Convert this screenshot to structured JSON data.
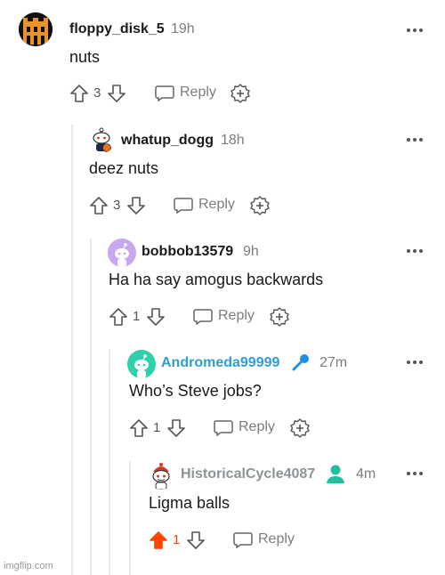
{
  "comments": [
    {
      "username": "floppy_disk_5",
      "time": "19h",
      "body": "nuts",
      "votes": "3",
      "reply_label": "Reply",
      "avatar_icon": "castle-avatar-icon"
    },
    {
      "username": "whatup_dogg",
      "time": "18h",
      "body": "deez nuts",
      "votes": "3",
      "reply_label": "Reply",
      "avatar_icon": "snoo-basketball-avatar-icon"
    },
    {
      "username": "bobbob13579",
      "time": "9h",
      "body": "Ha ha say amogus backwards",
      "votes": "1",
      "reply_label": "Reply",
      "avatar_icon": "snoo-purple-avatar-icon"
    },
    {
      "username": "Andromeda99999",
      "time": "27m",
      "body": "Who’s Steve jobs?",
      "votes": "1",
      "reply_label": "Reply",
      "avatar_icon": "snoo-teal-avatar-icon",
      "flair_icon": "microphone-icon"
    },
    {
      "username": "HistoricalCycle4087",
      "time": "4m",
      "body": "Ligma balls",
      "votes": "1",
      "reply_label": "Reply",
      "avatar_icon": "snoo-red-hat-avatar-icon",
      "flair_icon": "user-icon",
      "upvoted": true
    }
  ],
  "watermark": "imgflip.com",
  "colors": {
    "upvote": "#ff4500",
    "link_blue": "#2a9fd6",
    "teal": "#1fbf9f",
    "thread_line": "#e9e9e9"
  }
}
